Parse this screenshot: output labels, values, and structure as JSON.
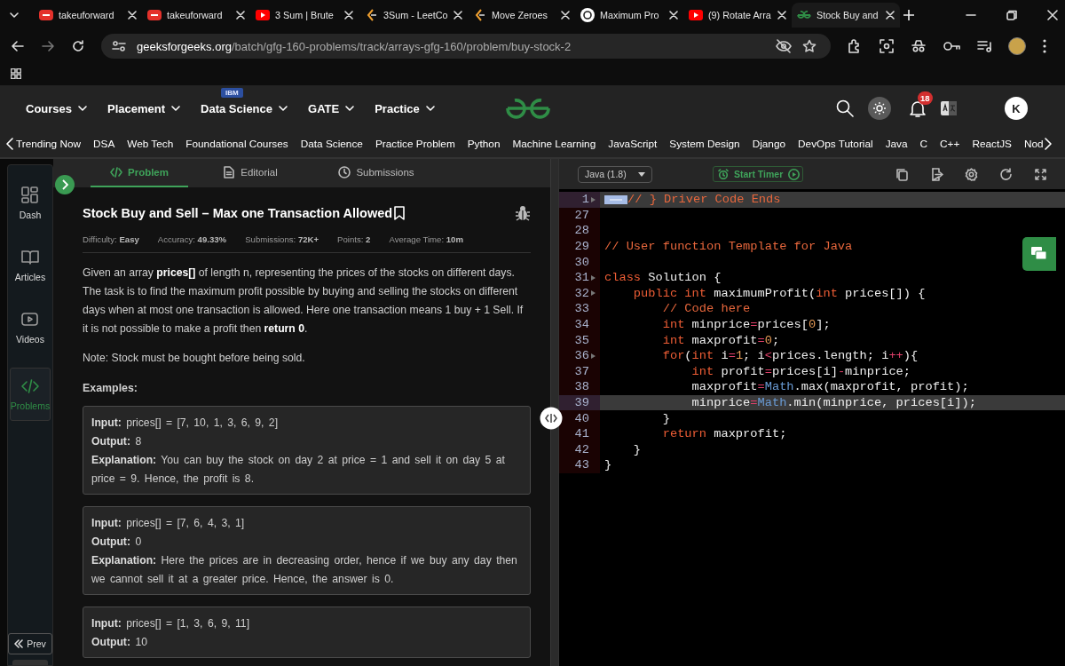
{
  "browser": {
    "tabs": [
      {
        "title": "takeuforward",
        "kind": "brand",
        "selected": false
      },
      {
        "title": "takeuforward",
        "kind": "brand",
        "selected": false
      },
      {
        "title": "3 Sum | Brute",
        "kind": "video",
        "selected": false
      },
      {
        "title": "3Sum - LeetCo",
        "kind": "chevron",
        "selected": false
      },
      {
        "title": "Move Zeroes",
        "kind": "chevron",
        "selected": false
      },
      {
        "title": "Maximum Pro",
        "kind": "knot",
        "selected": false
      },
      {
        "title": "(9) Rotate Arra",
        "kind": "video",
        "selected": false
      },
      {
        "title": "Stock Buy and",
        "kind": "site",
        "selected": true
      }
    ],
    "url_host": "geeksforgeeks.org",
    "url_path": "/batch/gfg-160-problems/track/arrays-gfg-160/problem/buy-stock-2"
  },
  "site_nav": {
    "menus": [
      {
        "label": "Courses"
      },
      {
        "label": "Placement"
      },
      {
        "label": "Data Science",
        "badge": "IBM"
      },
      {
        "label": "GATE"
      },
      {
        "label": "Practice"
      }
    ],
    "notifications": "18",
    "avatar": "K"
  },
  "categories": [
    "Trending Now",
    "DSA",
    "Web Tech",
    "Foundational Courses",
    "Data Science",
    "Practice Problem",
    "Python",
    "Machine Learning",
    "JavaScript",
    "System Design",
    "Django",
    "DevOps Tutorial",
    "Java",
    "C",
    "C++",
    "ReactJS",
    "Nod"
  ],
  "sidebar": [
    {
      "label": "Dash",
      "selected": false
    },
    {
      "label": "Articles",
      "selected": false
    },
    {
      "label": "Videos",
      "selected": false
    },
    {
      "label": "Problems",
      "selected": true
    }
  ],
  "prev_button": "Prev",
  "problem_tabs": [
    {
      "label": "Problem",
      "selected": true
    },
    {
      "label": "Editorial",
      "selected": false
    },
    {
      "label": "Submissions",
      "selected": false
    }
  ],
  "problem": {
    "title": "Stock Buy and Sell – Max one Transaction Allowed",
    "meta": [
      {
        "label": "Difficulty:",
        "value": "Easy"
      },
      {
        "label": "Accuracy:",
        "value": "49.33%"
      },
      {
        "label": "Submissions:",
        "value": "72K+"
      },
      {
        "label": "Points:",
        "value": "2"
      },
      {
        "label": "Average Time:",
        "value": "10m"
      }
    ],
    "description": [
      "Given an array **prices[]** of length n, representing the prices of the stocks on different days. The task is to find the maximum profit possible by buying and selling the stocks on different days when at most one transaction is allowed. Here one transaction means 1 buy + 1 Sell. If it is not possible to make a profit then **return 0**.",
      "Note: Stock must be bought before being sold."
    ],
    "examples_heading": "Examples:",
    "examples": [
      {
        "lines": [
          "**Input:** prices[] = [7, 10, 1, 3, 6, 9, 2]",
          "**Output:** 8",
          "**Explanation:** You can buy the stock on day 2 at price = 1 and sell it on day 5 at price = 9. Hence, the profit is 8."
        ]
      },
      {
        "lines": [
          "**Input:** prices[] = [7, 6, 4, 3, 1]",
          "**Output:** 0",
          "**Explanation:** Here the prices are in decreasing order, hence if we buy any day then we cannot sell it at a greater price. Hence, the answer is 0."
        ]
      },
      {
        "lines": [
          "**Input:** prices[] = [1, 3, 6, 9, 11]",
          "**Output:** 10"
        ]
      }
    ]
  },
  "editor": {
    "language": "Java (1.8)",
    "timer": "Start Timer",
    "lines": [
      {
        "n": "1",
        "fold": true,
        "folded": true,
        "highlighted": true,
        "tokens": [
          {
            "t": "// } Driver Code Ends",
            "kind": "comment"
          }
        ]
      },
      {
        "n": "27",
        "fold": false,
        "folded": false,
        "highlighted": false
      },
      {
        "n": "28",
        "fold": false,
        "folded": false,
        "highlighted": false
      },
      {
        "n": "29",
        "fold": false,
        "folded": false,
        "highlighted": false,
        "tokens": [
          {
            "t": "// User function Template for Java",
            "kind": "comment"
          }
        ]
      },
      {
        "n": "30",
        "fold": false,
        "folded": false,
        "highlighted": false
      },
      {
        "n": "31",
        "fold": true,
        "folded": false,
        "highlighted": false,
        "tokens": [
          {
            "t": "class",
            "kind": "keyword"
          },
          {
            "t": " Solution {",
            "kind": "plain"
          }
        ]
      },
      {
        "n": "32",
        "fold": true,
        "folded": false,
        "highlighted": false,
        "tokens": [
          {
            "t": "    public",
            "kind": "keyword"
          },
          {
            "t": " int",
            "kind": "keyword"
          },
          {
            "t": " maximumProfit(",
            "kind": "plain"
          },
          {
            "t": "int",
            "kind": "keyword"
          },
          {
            "t": " prices[]) {",
            "kind": "plain"
          }
        ]
      },
      {
        "n": "33",
        "fold": false,
        "folded": false,
        "highlighted": false,
        "tokens": [
          {
            "t": "        // Code here",
            "kind": "comment"
          }
        ]
      },
      {
        "n": "34",
        "fold": false,
        "folded": false,
        "highlighted": false,
        "tokens": [
          {
            "t": "        int",
            "kind": "keyword"
          },
          {
            "t": " minprice",
            "kind": "plain"
          },
          {
            "t": "=",
            "kind": "operator"
          },
          {
            "t": "prices[",
            "kind": "plain"
          },
          {
            "t": "0",
            "kind": "number"
          },
          {
            "t": "];",
            "kind": "plain"
          }
        ]
      },
      {
        "n": "35",
        "fold": false,
        "folded": false,
        "highlighted": false,
        "tokens": [
          {
            "t": "        int",
            "kind": "keyword"
          },
          {
            "t": " maxprofit",
            "kind": "plain"
          },
          {
            "t": "=",
            "kind": "operator"
          },
          {
            "t": "0",
            "kind": "number"
          },
          {
            "t": ";",
            "kind": "plain"
          }
        ]
      },
      {
        "n": "36",
        "fold": true,
        "folded": false,
        "highlighted": false,
        "tokens": [
          {
            "t": "        for",
            "kind": "keyword"
          },
          {
            "t": "(",
            "kind": "plain"
          },
          {
            "t": "int",
            "kind": "keyword"
          },
          {
            "t": " i",
            "kind": "plain"
          },
          {
            "t": "=",
            "kind": "operator"
          },
          {
            "t": "1",
            "kind": "number"
          },
          {
            "t": "; i",
            "kind": "plain"
          },
          {
            "t": "<",
            "kind": "operator"
          },
          {
            "t": "prices.length; i",
            "kind": "plain"
          },
          {
            "t": "++",
            "kind": "operator"
          },
          {
            "t": "){",
            "kind": "plain"
          }
        ]
      },
      {
        "n": "37",
        "fold": false,
        "folded": false,
        "highlighted": false,
        "tokens": [
          {
            "t": "            int",
            "kind": "keyword"
          },
          {
            "t": " profit",
            "kind": "plain"
          },
          {
            "t": "=",
            "kind": "operator"
          },
          {
            "t": "prices[i]",
            "kind": "plain"
          },
          {
            "t": "-",
            "kind": "operator"
          },
          {
            "t": "minprice;",
            "kind": "plain"
          }
        ]
      },
      {
        "n": "38",
        "fold": false,
        "folded": false,
        "highlighted": false,
        "tokens": [
          {
            "t": "            maxprofit",
            "kind": "plain"
          },
          {
            "t": "=",
            "kind": "operator"
          },
          {
            "t": "Math",
            "kind": "class"
          },
          {
            "t": ".max(maxprofit, profit);",
            "kind": "plain"
          }
        ]
      },
      {
        "n": "39",
        "fold": false,
        "folded": false,
        "highlighted": true,
        "tokens": [
          {
            "t": "            minprice",
            "kind": "plain"
          },
          {
            "t": "=",
            "kind": "operator"
          },
          {
            "t": "Math",
            "kind": "class"
          },
          {
            "t": ".min(minprice, prices[i]);",
            "kind": "plain"
          }
        ]
      },
      {
        "n": "40",
        "fold": false,
        "folded": false,
        "highlighted": false,
        "tokens": [
          {
            "t": "        }",
            "kind": "plain"
          }
        ]
      },
      {
        "n": "41",
        "fold": false,
        "folded": false,
        "highlighted": false,
        "tokens": [
          {
            "t": "        return",
            "kind": "keyword"
          },
          {
            "t": " maxprofit;",
            "kind": "plain"
          }
        ]
      },
      {
        "n": "42",
        "fold": false,
        "folded": false,
        "highlighted": false,
        "tokens": [
          {
            "t": "    }",
            "kind": "plain"
          }
        ]
      },
      {
        "n": "43",
        "fold": false,
        "folded": false,
        "highlighted": false,
        "tokens": [
          {
            "t": "}",
            "kind": "plain"
          }
        ]
      }
    ]
  }
}
